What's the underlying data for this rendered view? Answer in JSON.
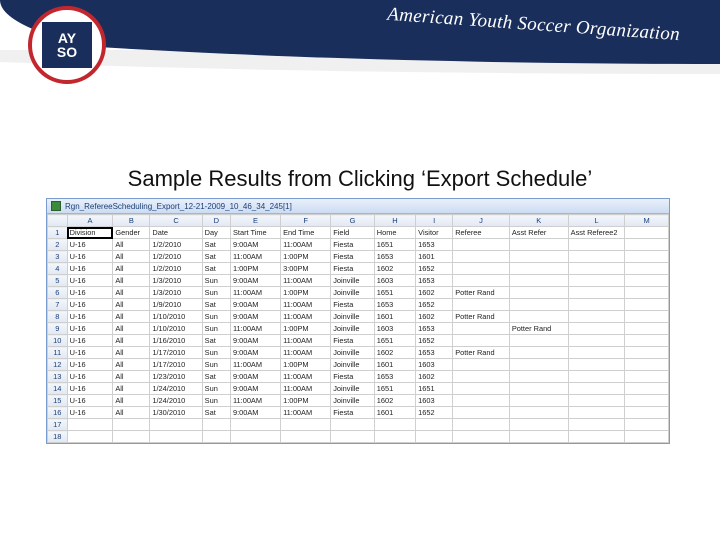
{
  "banner": {
    "org_text": "American Youth Soccer Organization",
    "logo_top": "AY",
    "logo_bottom": "SO"
  },
  "title": "Sample Results from Clicking ‘Export Schedule’",
  "workbook": {
    "filename": "Rgn_RefereeScheduling_Export_12-21-2009_10_46_34_245[1]"
  },
  "columns_letters": [
    "A",
    "B",
    "C",
    "D",
    "E",
    "F",
    "G",
    "H",
    "I",
    "J",
    "K",
    "L",
    "M"
  ],
  "headers": [
    "Division",
    "Gender",
    "Date",
    "Day",
    "Start Time",
    "End Time",
    "Field",
    "Home",
    "Visitor",
    "Referee",
    "Asst Refer",
    "Asst Referee2",
    ""
  ],
  "rows": [
    {
      "n": "2",
      "c": [
        "U-16",
        "All",
        "1/2/2010",
        "Sat",
        "9:00AM",
        "11:00AM",
        "Fiesta",
        "1651",
        "1653",
        "",
        "",
        "",
        ""
      ]
    },
    {
      "n": "3",
      "c": [
        "U-16",
        "All",
        "1/2/2010",
        "Sat",
        "11:00AM",
        "1:00PM",
        "Fiesta",
        "1653",
        "1601",
        "",
        "",
        "",
        ""
      ]
    },
    {
      "n": "4",
      "c": [
        "U-16",
        "All",
        "1/2/2010",
        "Sat",
        "1:00PM",
        "3:00PM",
        "Fiesta",
        "1602",
        "1652",
        "",
        "",
        "",
        ""
      ]
    },
    {
      "n": "5",
      "c": [
        "U-16",
        "All",
        "1/3/2010",
        "Sun",
        "9:00AM",
        "11:00AM",
        "Joinville",
        "1603",
        "1653",
        "",
        "",
        "",
        ""
      ]
    },
    {
      "n": "6",
      "c": [
        "U-16",
        "All",
        "1/3/2010",
        "Sun",
        "11:00AM",
        "1:00PM",
        "Joinville",
        "1651",
        "1602",
        "Potter Rand",
        "",
        "",
        ""
      ]
    },
    {
      "n": "7",
      "c": [
        "U-16",
        "All",
        "1/9/2010",
        "Sat",
        "9:00AM",
        "11:00AM",
        "Fiesta",
        "1653",
        "1652",
        "",
        "",
        "",
        ""
      ]
    },
    {
      "n": "8",
      "c": [
        "U-16",
        "All",
        "1/10/2010",
        "Sun",
        "9:00AM",
        "11:00AM",
        "Joinville",
        "1601",
        "1602",
        "Potter Rand",
        "",
        "",
        ""
      ]
    },
    {
      "n": "9",
      "c": [
        "U-16",
        "All",
        "1/10/2010",
        "Sun",
        "11:00AM",
        "1:00PM",
        "Joinville",
        "1603",
        "1653",
        "",
        "Potter Rand",
        "",
        ""
      ]
    },
    {
      "n": "10",
      "c": [
        "U-16",
        "All",
        "1/16/2010",
        "Sat",
        "9:00AM",
        "11:00AM",
        "Fiesta",
        "1651",
        "1652",
        "",
        "",
        "",
        ""
      ]
    },
    {
      "n": "11",
      "c": [
        "U-16",
        "All",
        "1/17/2010",
        "Sun",
        "9:00AM",
        "11:00AM",
        "Joinville",
        "1602",
        "1653",
        "Potter Rand",
        "",
        "",
        ""
      ]
    },
    {
      "n": "12",
      "c": [
        "U-16",
        "All",
        "1/17/2010",
        "Sun",
        "11:00AM",
        "1:00PM",
        "Joinville",
        "1601",
        "1603",
        "",
        "",
        "",
        ""
      ]
    },
    {
      "n": "13",
      "c": [
        "U-16",
        "All",
        "1/23/2010",
        "Sat",
        "9:00AM",
        "11:00AM",
        "Fiesta",
        "1653",
        "1602",
        "",
        "",
        "",
        ""
      ]
    },
    {
      "n": "14",
      "c": [
        "U-16",
        "All",
        "1/24/2010",
        "Sun",
        "9:00AM",
        "11:00AM",
        "Joinville",
        "1651",
        "1651",
        "",
        "",
        "",
        ""
      ]
    },
    {
      "n": "15",
      "c": [
        "U-16",
        "All",
        "1/24/2010",
        "Sun",
        "11:00AM",
        "1:00PM",
        "Joinville",
        "1602",
        "1603",
        "",
        "",
        "",
        ""
      ]
    },
    {
      "n": "16",
      "c": [
        "U-16",
        "All",
        "1/30/2010",
        "Sat",
        "9:00AM",
        "11:00AM",
        "Fiesta",
        "1601",
        "1652",
        "",
        "",
        "",
        ""
      ]
    },
    {
      "n": "17",
      "c": [
        "",
        "",
        "",
        "",
        "",
        "",
        "",
        "",
        "",
        "",
        "",
        "",
        ""
      ]
    },
    {
      "n": "18",
      "c": [
        "",
        "",
        "",
        "",
        "",
        "",
        "",
        "",
        "",
        "",
        "",
        "",
        ""
      ]
    }
  ]
}
